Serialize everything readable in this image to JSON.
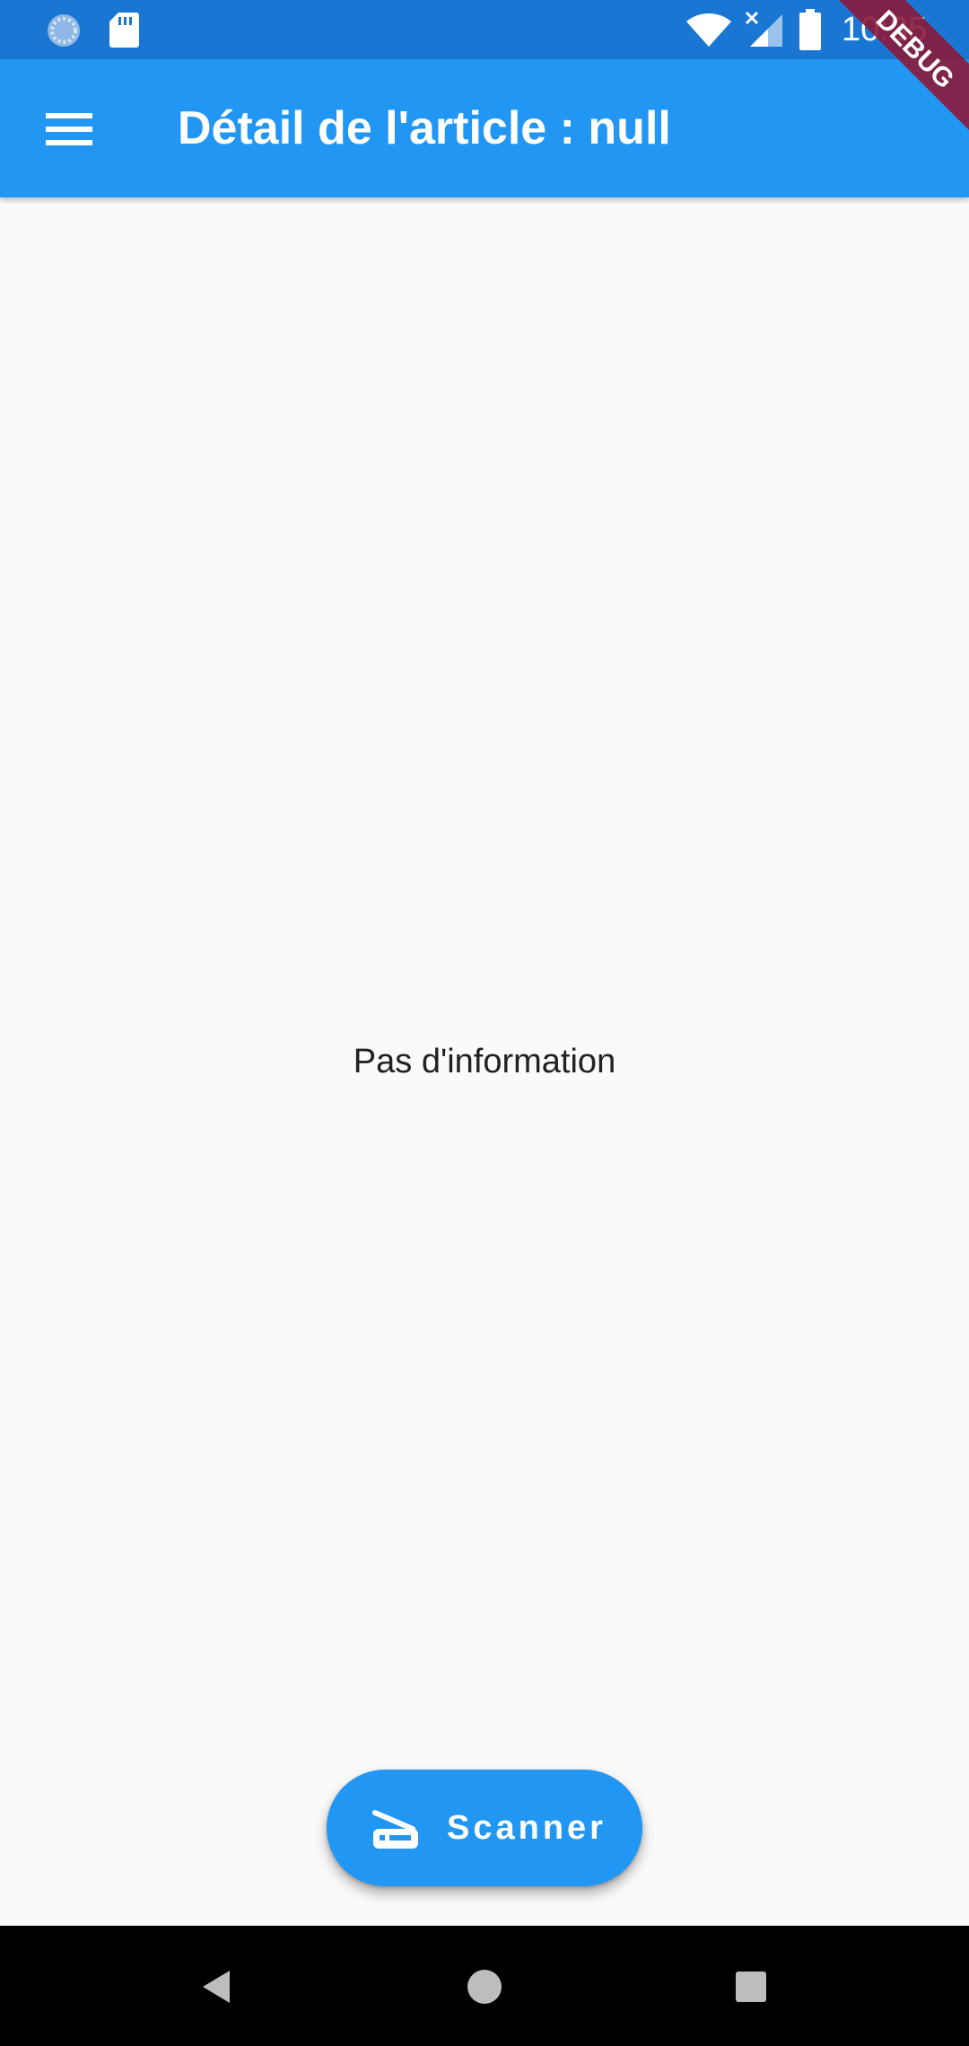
{
  "status_bar": {
    "time": "10:35",
    "icons": [
      "sync-icon",
      "sd-card-icon",
      "wifi-icon",
      "signal-no-data-icon",
      "battery-icon"
    ]
  },
  "app_bar": {
    "title": "Détail de l'article : null",
    "menu_icon": "menu-icon",
    "color": "#2196f3"
  },
  "debug_banner": {
    "label": "DEBUG",
    "color": "#8b1a3a"
  },
  "body": {
    "message": "Pas d'information"
  },
  "fab": {
    "label": "Scanner",
    "icon": "scanner-icon",
    "color": "#2196f3"
  },
  "nav_bar": {
    "buttons": [
      "back-icon",
      "home-icon",
      "recents-icon"
    ]
  }
}
